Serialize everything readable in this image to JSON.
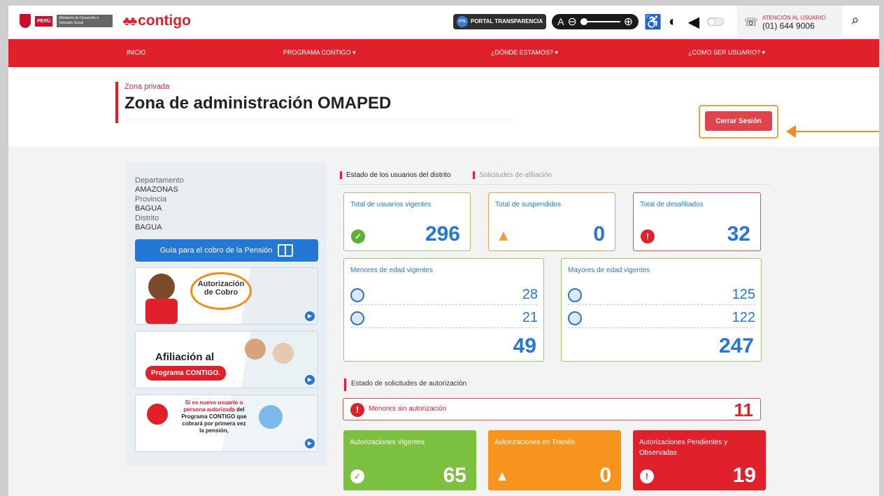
{
  "topbar": {
    "peru_label": "PERÚ",
    "ministry_label": "Ministerio de Desarrollo e Inclusión Social",
    "brand_name": "contigo",
    "portal_label": "PORTAL TRANSPARENCIA",
    "portal_badge": "PTE",
    "zoom_letter": "A",
    "attention_label": "ATENCIÓN AL USUARIO",
    "phone_number": "(01) 644 9006"
  },
  "nav": {
    "items": [
      {
        "label": "INICIO"
      },
      {
        "label": "PROGRAMA CONTIGO ▾"
      },
      {
        "label": "¿DÓNDE ESTAMOS? ▾"
      },
      {
        "label": "¿COMO SER USUARIO? ▾"
      }
    ]
  },
  "header": {
    "subtitle": "Zona privada",
    "title": "Zona de administración OMAPED",
    "logout_label": "Cerrar Sesión"
  },
  "sidebar": {
    "department_label": "Departamento",
    "department_value": "AMAZONAS",
    "province_label": "Provincia",
    "province_value": "BAGUA",
    "district_label": "Distrito",
    "district_value": "BAGUA",
    "guide_button": "Guía para el cobro de la Pensión",
    "banner1_text": "Autorización de Cobro",
    "banner2_title": "Afiliación al",
    "banner2_pill": "Programa CONTIGO.",
    "banner3_text_a": "Si es nuevo usuario o persona autorizada",
    "banner3_text_b": "del Programa CONTIGO que cobrará por primera vez la pensión,"
  },
  "tabs": [
    {
      "label": "Estado de los usuarios del distrito"
    },
    {
      "label": "Solicitudes de afiliación"
    }
  ],
  "stats": {
    "vigentes": {
      "label": "Total de usuarios vigentes",
      "value": "296"
    },
    "suspendidos": {
      "label": "Total de suspendidos",
      "value": "0"
    },
    "desafiliados": {
      "label": "Total de desafiliados",
      "value": "32"
    },
    "menores": {
      "label": "Menores de edad vigentes",
      "row1": "28",
      "row2": "21",
      "total": "49"
    },
    "mayores": {
      "label": "Mayores de edad vigentes",
      "row1": "125",
      "row2": "122",
      "total": "247"
    }
  },
  "authorizations": {
    "section_title": "Estado de solicitudes de autorización",
    "alert_label": "Menores sin autorización",
    "alert_value": "11",
    "vigentes": {
      "label": "Autorizaciones Vigentes",
      "value": "65"
    },
    "tramite": {
      "label": "Autorizaciones en Trámite",
      "value": "0"
    },
    "pendientes": {
      "label": "Autorizaciones Pendientes y Observadas",
      "value": "19"
    }
  },
  "colors": {
    "brand_red": "#e0202a",
    "accent_blue": "#2477d3",
    "highlight_orange": "#f58a1f",
    "status_green": "#7cc040",
    "status_orange": "#f7941d"
  }
}
